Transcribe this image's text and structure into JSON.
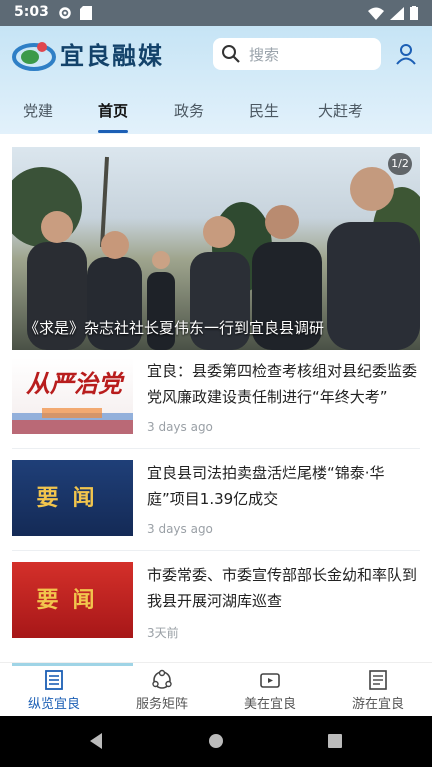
{
  "status_bar": {
    "time": "5:03"
  },
  "header": {
    "logo_text": "宜良融媒",
    "search_placeholder": "搜索"
  },
  "tabs": [
    {
      "label": "党建",
      "active": false
    },
    {
      "label": "首页",
      "active": true
    },
    {
      "label": "政务",
      "active": false
    },
    {
      "label": "民生",
      "active": false
    },
    {
      "label": "大赶考",
      "active": false
    }
  ],
  "hero": {
    "caption": "《求是》杂志社社长夏伟东一行到宜良县调研",
    "counter": "1/2"
  },
  "news": [
    {
      "title": "宜良：县委第四检查考核组对县纪委监委党风廉政建设责任制进行“年终大考”",
      "time": "3 days ago",
      "thumb_text": "从严治党"
    },
    {
      "title": "宜良县司法拍卖盘活烂尾楼“锦泰·华庭”项目1.39亿成交",
      "time": "3 days ago",
      "thumb_text": "要闻"
    },
    {
      "title": "市委常委、市委宣传部部长金幼和率队到我县开展河湖库巡查",
      "time": "3天前",
      "thumb_text": "要闻"
    }
  ],
  "bottom_nav": [
    {
      "label": "纵览宜良",
      "icon": "newspaper-icon",
      "active": true
    },
    {
      "label": "服务矩阵",
      "icon": "service-matrix-icon",
      "active": false
    },
    {
      "label": "美在宜良",
      "icon": "video-icon",
      "active": false
    },
    {
      "label": "游在宜良",
      "icon": "document-icon",
      "active": false
    }
  ],
  "colors": {
    "accent": "#1c5fb5",
    "header_bg": "#c6e4f5",
    "status_bar": "#5d6a75"
  }
}
